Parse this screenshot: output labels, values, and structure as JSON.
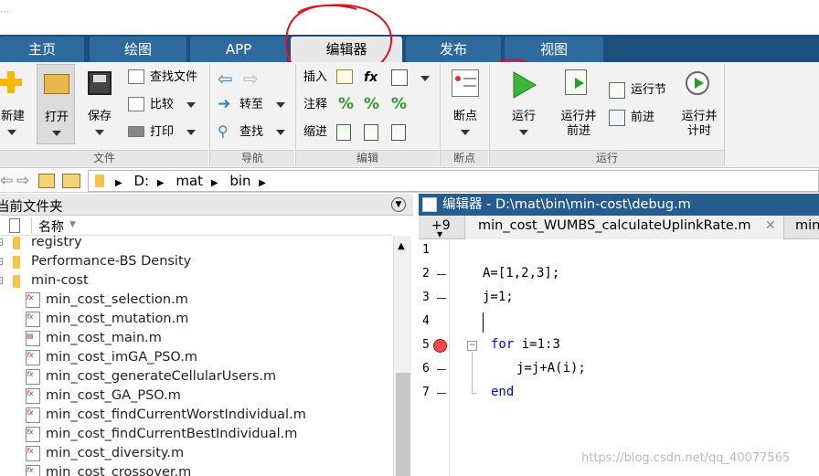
{
  "tabs": [
    {
      "label": "主页"
    },
    {
      "label": "绘图"
    },
    {
      "label": "APP"
    },
    {
      "label": "编辑器"
    },
    {
      "label": "发布"
    },
    {
      "label": "视图"
    }
  ],
  "ribbon": {
    "file": {
      "new": "新建",
      "open": "打开",
      "save": "保存",
      "find_files": "查找文件",
      "compare": "比较",
      "print": "打印",
      "group": "文件"
    },
    "nav": {
      "goto": "转至",
      "find": "查找",
      "group": "导航"
    },
    "edit": {
      "insert": "插入",
      "comment": "注释",
      "indent": "缩进",
      "fx": "fx",
      "group": "编辑"
    },
    "breakpoints": {
      "label": "断点",
      "group": "断点"
    },
    "run": {
      "run": "运行",
      "run_advance": "运行并\n前进",
      "run_section": "运行节",
      "advance": "前进",
      "run_time": "运行并\n计时",
      "group": "运行"
    }
  },
  "address": {
    "drive": "D:",
    "p1": "mat",
    "p2": "bin"
  },
  "left_panel": {
    "title": "当前文件夹",
    "col_name": "名称",
    "items": [
      {
        "name": "registry",
        "type": "folder"
      },
      {
        "name": "Performance-BS Density",
        "type": "folder"
      },
      {
        "name": "min-cost",
        "type": "folder"
      },
      {
        "name": "min_cost_selection.m",
        "type": "fx"
      },
      {
        "name": "min_cost_mutation.m",
        "type": "fx"
      },
      {
        "name": "min_cost_main.m",
        "type": "script"
      },
      {
        "name": "min_cost_imGA_PSO.m",
        "type": "fx"
      },
      {
        "name": "min_cost_generateCellularUsers.m",
        "type": "fx"
      },
      {
        "name": "min_cost_GA_PSO.m",
        "type": "fx"
      },
      {
        "name": "min_cost_findCurrentWorstIndividual.m",
        "type": "fx"
      },
      {
        "name": "min_cost_findCurrentBestIndividual.m",
        "type": "fx"
      },
      {
        "name": "min_cost_diversity.m",
        "type": "fx"
      },
      {
        "name": "min_cost_crossover.m",
        "type": "fx"
      }
    ]
  },
  "editor": {
    "title": "编辑器 - D:\\mat\\bin\\min-cost\\debug.m",
    "more_tabs": "+9",
    "tab1": "min_cost_WUMBS_calculateUplinkRate.m",
    "tab2": "min",
    "lines": [
      {
        "n": "1",
        "code": ""
      },
      {
        "n": "2",
        "code": "A=[1,2,3];"
      },
      {
        "n": "3",
        "code": "j=1;"
      },
      {
        "n": "4",
        "code": ""
      },
      {
        "n": "5",
        "kw": "for",
        "code": " i=1:3"
      },
      {
        "n": "6",
        "code": "j=j+A(i);"
      },
      {
        "n": "7",
        "kw": "end",
        "code": ""
      }
    ]
  },
  "watermark": "https://blog.csdn.net/qq_40077565"
}
